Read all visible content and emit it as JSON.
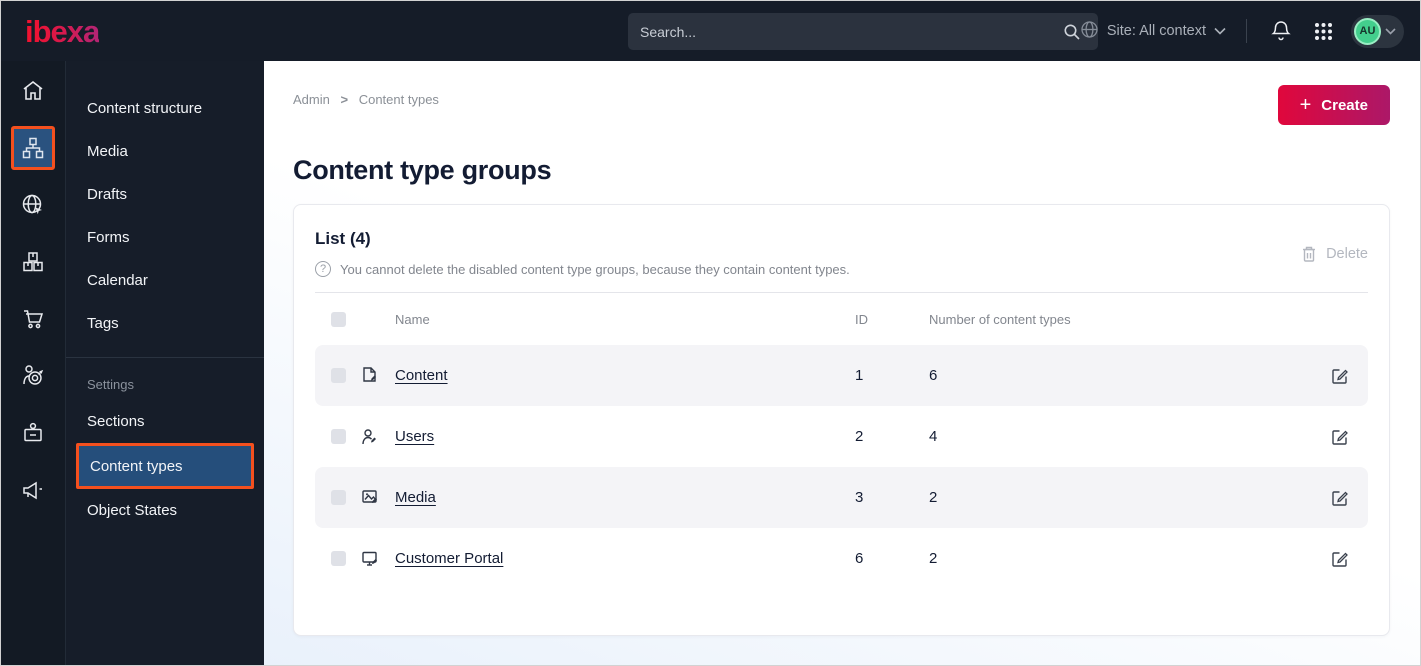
{
  "topbar": {
    "logo": "ibexa",
    "search": {
      "placeholder": "Search..."
    },
    "site_selector": "Site: All context",
    "avatar_initials": "AU"
  },
  "icon_rail": {
    "items": [
      "dashboard",
      "content-structure",
      "site",
      "product-catalog",
      "commerce",
      "personalization",
      "customer-portal",
      "campaigns"
    ],
    "active_item": "content-structure"
  },
  "sidebar": {
    "items": [
      {
        "label": "Content structure"
      },
      {
        "label": "Media"
      },
      {
        "label": "Drafts"
      },
      {
        "label": "Forms"
      },
      {
        "label": "Calendar"
      },
      {
        "label": "Tags"
      }
    ],
    "section_label": "Settings",
    "settings_items": [
      {
        "label": "Sections",
        "active": false
      },
      {
        "label": "Content types",
        "active": true
      },
      {
        "label": "Object States",
        "active": false
      }
    ]
  },
  "main": {
    "breadcrumb": {
      "0": "Admin",
      "1": "Content types",
      "separator": ">"
    },
    "create_label": "Create",
    "page_title": "Content type groups",
    "card": {
      "list_title": "List (4)",
      "help_text": "You cannot delete the disabled content type groups, because they contain content types.",
      "delete_label": "Delete",
      "table": {
        "columns": {
          "name": "Name",
          "id": "ID",
          "count": "Number of content types"
        },
        "rows": [
          {
            "name": "Content",
            "icon": "content-file-icon",
            "id": "1",
            "count": "6"
          },
          {
            "name": "Users",
            "icon": "user-icon",
            "id": "2",
            "count": "4"
          },
          {
            "name": "Media",
            "icon": "media-image-icon",
            "id": "3",
            "count": "2"
          },
          {
            "name": "Customer Portal",
            "icon": "portal-monitor-icon",
            "id": "6",
            "count": "2"
          }
        ]
      }
    }
  },
  "colors": {
    "topbar_bg": "#151c28",
    "active_highlight_border": "#f4501e",
    "active_item_bg": "#254e7b",
    "create_gradient_start": "#e0073c",
    "create_gradient_end": "#ac1868",
    "avatar_green": "#43cf8d",
    "row_shaded_bg": "#f4f4f7",
    "text_dark": "#131c33",
    "text_muted": "#82868e"
  },
  "icons": {
    "search": "magnifier",
    "notifications": "bell",
    "apps": "grid-9-dots",
    "delete": "trash",
    "edit": "pencil-square",
    "help": "?"
  }
}
